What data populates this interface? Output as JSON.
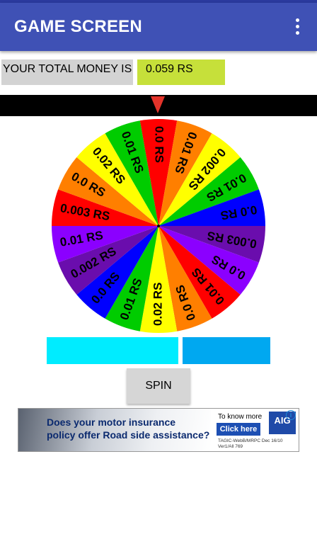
{
  "appbar": {
    "title": "GAME SCREEN",
    "menu_icon": "more-vert-icon"
  },
  "money": {
    "label": "YOUR TOTAL MONEY IS",
    "value": "0.059  RS"
  },
  "wheel": {
    "segments": [
      {
        "label": "0.0 RS",
        "color": "#ff0000"
      },
      {
        "label": "0.01 RS",
        "color": "#ff7f00"
      },
      {
        "label": "0.002 RS",
        "color": "#ffff00"
      },
      {
        "label": "0.01 RS",
        "color": "#00cc00"
      },
      {
        "label": "0.0 RS",
        "color": "#0000ff"
      },
      {
        "label": "0.003 RS",
        "color": "#6a0dad"
      },
      {
        "label": "0.0 RS",
        "color": "#8b00ff"
      },
      {
        "label": "0.01 RS",
        "color": "#ff0000"
      },
      {
        "label": "0.0 RS",
        "color": "#ff7f00"
      },
      {
        "label": "0.02 RS",
        "color": "#ffff00"
      },
      {
        "label": "0.01 RS",
        "color": "#00cc00"
      },
      {
        "label": "0.0 RS",
        "color": "#0000ff"
      },
      {
        "label": "0.002 RS",
        "color": "#6a0dad"
      },
      {
        "label": "0.01 RS",
        "color": "#8b00ff"
      },
      {
        "label": "0.003 RS",
        "color": "#ff0000"
      },
      {
        "label": "0.0 RS",
        "color": "#ff7f00"
      },
      {
        "label": "0.02 RS",
        "color": "#ffff00"
      },
      {
        "label": "0.01 RS",
        "color": "#00cc00"
      }
    ],
    "pointer_color": "#e4332a"
  },
  "spin": {
    "label": "SPIN"
  },
  "ad": {
    "headline_1": "Does your motor insurance",
    "headline_2": "policy offer Road side assistance?",
    "know_more": "To know more",
    "cta": "Click here",
    "brand": "AIG",
    "fine_print_1": "TAGIC-WebB/MRPC Dec 16/10",
    "fine_print_2": "Ver1/All 769"
  },
  "colors": {
    "appbar": "#3f51b5",
    "money_value_bg": "#c6e03a",
    "box_cyan": "#00ecff",
    "box_blue": "#00a8f0"
  }
}
